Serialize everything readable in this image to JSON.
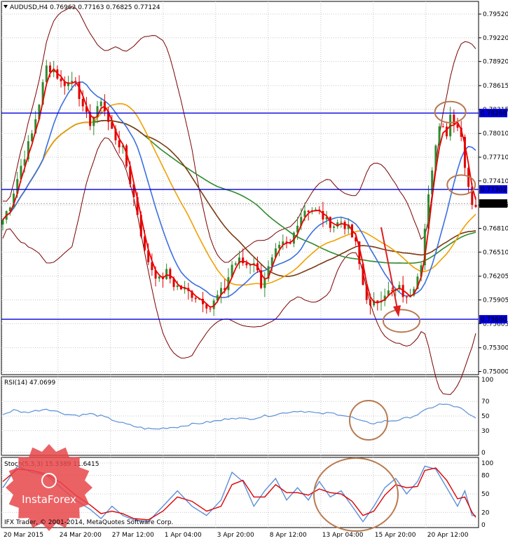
{
  "colors": {
    "background": "#ffffff",
    "grid": "#c8c8c8",
    "candle_up": "#2e8b2e",
    "candle_down": "#e00000",
    "level_line": "#0000dd",
    "bb_band": "#7a0000",
    "ma_red": "#ee0000",
    "ma_blue": "#3b6fe0",
    "ma_orange": "#f0a000",
    "ma_brown": "#7a3a14",
    "ma_green": "#2e8b2e",
    "rsi": "#5b8fd9",
    "stoch_main": "#5b8fd9",
    "stoch_signal": "#dd0000",
    "annotation": "#b87a50",
    "arrow": "#dd2020",
    "label_bg_blue": "#0000dd",
    "label_bg_dark": "#000000"
  },
  "main": {
    "title": "AUDUSD,H4  0.76962  0.77163  0.76825  0.77124",
    "last_price_label": "0.77124"
  },
  "rsi_pane": {
    "title": "RSI(14) 47.0699"
  },
  "stoch_pane": {
    "title": "Stoch(5,3,3) 15.3389 11.6415"
  },
  "watermark": {
    "brand": "InstaForex"
  },
  "footer": {
    "copyright": "IFX Trader, © 2001-2014, MetaQuotes Software Corp."
  },
  "chart_data": [
    {
      "type": "candlestick",
      "pane": "main",
      "symbol": "AUDUSD",
      "timeframe": "H4",
      "ohlc_last": {
        "open": 0.76962,
        "high": 0.77163,
        "low": 0.76825,
        "close": 0.77124
      },
      "ylim": [
        0.7496,
        0.7968
      ],
      "y_ticks": [
        "0.79520",
        "0.79220",
        "0.78920",
        "0.78615",
        "0.78315",
        "0.78010",
        "0.77710",
        "0.77410",
        "0.77105",
        "0.76810",
        "0.76510",
        "0.76205",
        "0.75905",
        "0.75605",
        "0.75300",
        "0.75000"
      ],
      "x_ticks": [
        "20 Mar 2015",
        "24 Mar 20:00",
        "27 Mar 12:00",
        "1 Apr 04:00",
        "3 Apr 20:00",
        "8 Apr 12:00",
        "13 Apr 04:00",
        "15 Apr 20:00",
        "20 Apr 12:00"
      ],
      "bar_count": 131,
      "price_path": [
        [
          0,
          0.7692
        ],
        [
          2,
          0.7712
        ],
        [
          5,
          0.776
        ],
        [
          8,
          0.78
        ],
        [
          10,
          0.784
        ],
        [
          12,
          0.7885
        ],
        [
          14,
          0.7882
        ],
        [
          16,
          0.7865
        ],
        [
          18,
          0.7865
        ],
        [
          20,
          0.787
        ],
        [
          22,
          0.783
        ],
        [
          24,
          0.7815
        ],
        [
          26,
          0.783
        ],
        [
          27,
          0.7845
        ],
        [
          29,
          0.7815
        ],
        [
          31,
          0.7795
        ],
        [
          33,
          0.778
        ],
        [
          35,
          0.774
        ],
        [
          37,
          0.77
        ],
        [
          39,
          0.765
        ],
        [
          41,
          0.763
        ],
        [
          43,
          0.7615
        ],
        [
          45,
          0.7625
        ],
        [
          47,
          0.761
        ],
        [
          49,
          0.7605
        ],
        [
          51,
          0.76
        ],
        [
          53,
          0.7595
        ],
        [
          55,
          0.759
        ],
        [
          57,
          0.758
        ],
        [
          59,
          0.7595
        ],
        [
          61,
          0.7605
        ],
        [
          63,
          0.7635
        ],
        [
          65,
          0.764
        ],
        [
          67,
          0.7635
        ],
        [
          69,
          0.764
        ],
        [
          71,
          0.761
        ],
        [
          73,
          0.763
        ],
        [
          75,
          0.765
        ],
        [
          77,
          0.766
        ],
        [
          79,
          0.766
        ],
        [
          81,
          0.769
        ],
        [
          83,
          0.7705
        ],
        [
          85,
          0.7705
        ],
        [
          87,
          0.77
        ],
        [
          89,
          0.769
        ],
        [
          91,
          0.7685
        ],
        [
          93,
          0.769
        ],
        [
          95,
          0.768
        ],
        [
          97,
          0.766
        ],
        [
          99,
          0.761
        ],
        [
          101,
          0.758
        ],
        [
          103,
          0.759
        ],
        [
          105,
          0.76
        ],
        [
          107,
          0.76
        ],
        [
          109,
          0.7605
        ],
        [
          111,
          0.759
        ],
        [
          113,
          0.761
        ],
        [
          115,
          0.764
        ],
        [
          116,
          0.768
        ],
        [
          117,
          0.772
        ],
        [
          118,
          0.775
        ],
        [
          119,
          0.779
        ],
        [
          120,
          0.781
        ],
        [
          121,
          0.7815
        ],
        [
          122,
          0.78
        ],
        [
          123,
          0.7825
        ],
        [
          124,
          0.7818
        ],
        [
          125,
          0.781
        ],
        [
          126,
          0.78
        ],
        [
          127,
          0.776
        ],
        [
          128,
          0.773
        ],
        [
          129,
          0.7715
        ],
        [
          130,
          0.7712
        ]
      ],
      "levels": [
        {
          "name": "resistance-1",
          "value": 0.78268,
          "label": "0.78268"
        },
        {
          "name": "resistance-2",
          "value": 0.77302,
          "label": "0.77302"
        },
        {
          "name": "support-1",
          "value": 0.7566,
          "label": "0.75660"
        }
      ],
      "indicators": [
        "Bollinger Bands",
        "Moving Averages (5 lines)"
      ],
      "annotations": [
        "circle at recent top",
        "circle at 0.7730 test",
        "arrow pointing down to 0.7566 target"
      ]
    },
    {
      "type": "line",
      "pane": "rsi",
      "name": "RSI(14)",
      "last_value": 47.0699,
      "ylim": [
        0,
        100
      ],
      "y_ticks": [
        "100",
        "70",
        "50",
        "30",
        "0"
      ],
      "path": [
        [
          0,
          52
        ],
        [
          3,
          58
        ],
        [
          6,
          55
        ],
        [
          9,
          57
        ],
        [
          12,
          60
        ],
        [
          15,
          56
        ],
        [
          18,
          52
        ],
        [
          21,
          51
        ],
        [
          24,
          53
        ],
        [
          27,
          50
        ],
        [
          30,
          45
        ],
        [
          33,
          40
        ],
        [
          36,
          36
        ],
        [
          39,
          33
        ],
        [
          42,
          32
        ],
        [
          45,
          34
        ],
        [
          48,
          35
        ],
        [
          51,
          38
        ],
        [
          54,
          40
        ],
        [
          57,
          42
        ],
        [
          60,
          44
        ],
        [
          63,
          48
        ],
        [
          66,
          46
        ],
        [
          69,
          47
        ],
        [
          72,
          50
        ],
        [
          75,
          52
        ],
        [
          78,
          55
        ],
        [
          81,
          57
        ],
        [
          84,
          56
        ],
        [
          87,
          53
        ],
        [
          90,
          54
        ],
        [
          93,
          52
        ],
        [
          96,
          48
        ],
        [
          99,
          42
        ],
        [
          102,
          40
        ],
        [
          105,
          43
        ],
        [
          108,
          44
        ],
        [
          111,
          47
        ],
        [
          114,
          52
        ],
        [
          117,
          60
        ],
        [
          120,
          66
        ],
        [
          123,
          65
        ],
        [
          126,
          60
        ],
        [
          128,
          52
        ],
        [
          130,
          47
        ]
      ]
    },
    {
      "type": "line",
      "pane": "stoch",
      "name": "Stoch(5,3,3)",
      "main_last": 15.3389,
      "signal_last": 11.6415,
      "ylim": [
        0,
        100
      ],
      "y_ticks": [
        "100",
        "80",
        "50",
        "20",
        "0"
      ],
      "main_path": [
        [
          0,
          60
        ],
        [
          4,
          95
        ],
        [
          8,
          85
        ],
        [
          12,
          80
        ],
        [
          16,
          60
        ],
        [
          20,
          40
        ],
        [
          24,
          25
        ],
        [
          27,
          10
        ],
        [
          30,
          30
        ],
        [
          33,
          15
        ],
        [
          36,
          8
        ],
        [
          40,
          5
        ],
        [
          44,
          30
        ],
        [
          48,
          55
        ],
        [
          52,
          30
        ],
        [
          56,
          15
        ],
        [
          60,
          40
        ],
        [
          63,
          85
        ],
        [
          66,
          70
        ],
        [
          69,
          30
        ],
        [
          72,
          55
        ],
        [
          75,
          75
        ],
        [
          78,
          40
        ],
        [
          81,
          60
        ],
        [
          84,
          40
        ],
        [
          87,
          70
        ],
        [
          90,
          45
        ],
        [
          93,
          55
        ],
        [
          96,
          30
        ],
        [
          99,
          5
        ],
        [
          102,
          30
        ],
        [
          105,
          60
        ],
        [
          108,
          75
        ],
        [
          111,
          50
        ],
        [
          114,
          70
        ],
        [
          116,
          95
        ],
        [
          119,
          90
        ],
        [
          122,
          60
        ],
        [
          125,
          30
        ],
        [
          127,
          55
        ],
        [
          129,
          15
        ],
        [
          130,
          15
        ]
      ],
      "signal_path": [
        [
          0,
          70
        ],
        [
          4,
          90
        ],
        [
          8,
          88
        ],
        [
          12,
          82
        ],
        [
          16,
          68
        ],
        [
          20,
          48
        ],
        [
          24,
          32
        ],
        [
          27,
          18
        ],
        [
          30,
          22
        ],
        [
          33,
          18
        ],
        [
          36,
          10
        ],
        [
          40,
          8
        ],
        [
          44,
          22
        ],
        [
          48,
          45
        ],
        [
          52,
          38
        ],
        [
          56,
          22
        ],
        [
          60,
          30
        ],
        [
          63,
          65
        ],
        [
          66,
          72
        ],
        [
          69,
          45
        ],
        [
          72,
          45
        ],
        [
          75,
          65
        ],
        [
          78,
          52
        ],
        [
          81,
          52
        ],
        [
          84,
          48
        ],
        [
          87,
          58
        ],
        [
          90,
          52
        ],
        [
          93,
          50
        ],
        [
          96,
          38
        ],
        [
          99,
          15
        ],
        [
          102,
          22
        ],
        [
          105,
          48
        ],
        [
          108,
          65
        ],
        [
          111,
          60
        ],
        [
          114,
          62
        ],
        [
          116,
          88
        ],
        [
          119,
          92
        ],
        [
          122,
          72
        ],
        [
          125,
          42
        ],
        [
          127,
          45
        ],
        [
          129,
          20
        ],
        [
          130,
          12
        ]
      ]
    }
  ]
}
